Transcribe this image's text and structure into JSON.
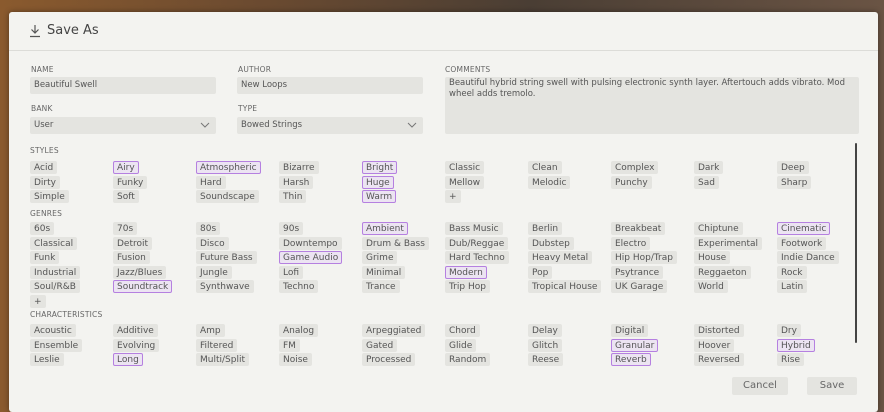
{
  "dialog": {
    "title": "Save As"
  },
  "fields": {
    "name_label": "NAME",
    "name_value": "Beautiful Swell",
    "author_label": "AUTHOR",
    "author_value": "New Loops",
    "bank_label": "BANK",
    "bank_value": "User",
    "type_label": "TYPE",
    "type_value": "Bowed Strings",
    "comments_label": "COMMENTS",
    "comments_value": "Beautiful hybrid string swell with pulsing electronic synth layer. Aftertouch adds vibrato. Mod wheel adds tremolo."
  },
  "sections": {
    "styles": "STYLES",
    "genres": "GENRES",
    "characteristics": "CHARACTERISTICS"
  },
  "add_label": "+",
  "styles": [
    [
      "Acid",
      "Airy",
      "Atmospheric",
      "Bizarre",
      "Bright",
      "Classic",
      "Clean",
      "Complex",
      "Dark",
      "Deep"
    ],
    [
      "Dirty",
      "Funky",
      "Hard",
      "Harsh",
      "Huge",
      "Mellow",
      "Melodic",
      "Punchy",
      "Sad",
      "Sharp"
    ],
    [
      "Simple",
      "Soft",
      "Soundscape",
      "Thin",
      "Warm",
      "+"
    ]
  ],
  "styles_selected": [
    "Airy",
    "Atmospheric",
    "Bright",
    "Huge",
    "Warm"
  ],
  "genres": [
    [
      "60s",
      "70s",
      "80s",
      "90s",
      "Ambient",
      "Bass Music",
      "Berlin",
      "Breakbeat",
      "Chiptune",
      "Cinematic"
    ],
    [
      "Classical",
      "Detroit",
      "Disco",
      "Downtempo",
      "Drum & Bass",
      "Dub/Reggae",
      "Dubstep",
      "Electro",
      "Experimental",
      "Footwork"
    ],
    [
      "Funk",
      "Fusion",
      "Future Bass",
      "Game Audio",
      "Grime",
      "Hard Techno",
      "Heavy Metal",
      "Hip Hop/Trap",
      "House",
      "Indie Dance"
    ],
    [
      "Industrial",
      "Jazz/Blues",
      "Jungle",
      "Lofi",
      "Minimal",
      "Modern",
      "Pop",
      "Psytrance",
      "Reggaeton",
      "Rock"
    ],
    [
      "Soul/R&B",
      "Soundtrack",
      "Synthwave",
      "Techno",
      "Trance",
      "Trip Hop",
      "Tropical House",
      "UK Garage",
      "World",
      "Latin"
    ],
    [
      "+"
    ]
  ],
  "genres_selected": [
    "Ambient",
    "Cinematic",
    "Game Audio",
    "Modern",
    "Soundtrack"
  ],
  "characteristics": [
    [
      "Acoustic",
      "Additive",
      "Amp",
      "Analog",
      "Arpeggiated",
      "Chord",
      "Delay",
      "Digital",
      "Distorted",
      "Dry"
    ],
    [
      "Ensemble",
      "Evolving",
      "Filtered",
      "FM",
      "Gated",
      "Glide",
      "Glitch",
      "Granular",
      "Hoover",
      "Hybrid"
    ],
    [
      "Leslie",
      "Long",
      "Multi/Split",
      "Noise",
      "Processed",
      "Random",
      "Reese",
      "Reverb",
      "Reversed",
      "Rise"
    ]
  ],
  "characteristics_selected": [
    "Granular",
    "Hybrid",
    "Long",
    "Reverb"
  ],
  "buttons": {
    "cancel": "Cancel",
    "save": "Save"
  }
}
